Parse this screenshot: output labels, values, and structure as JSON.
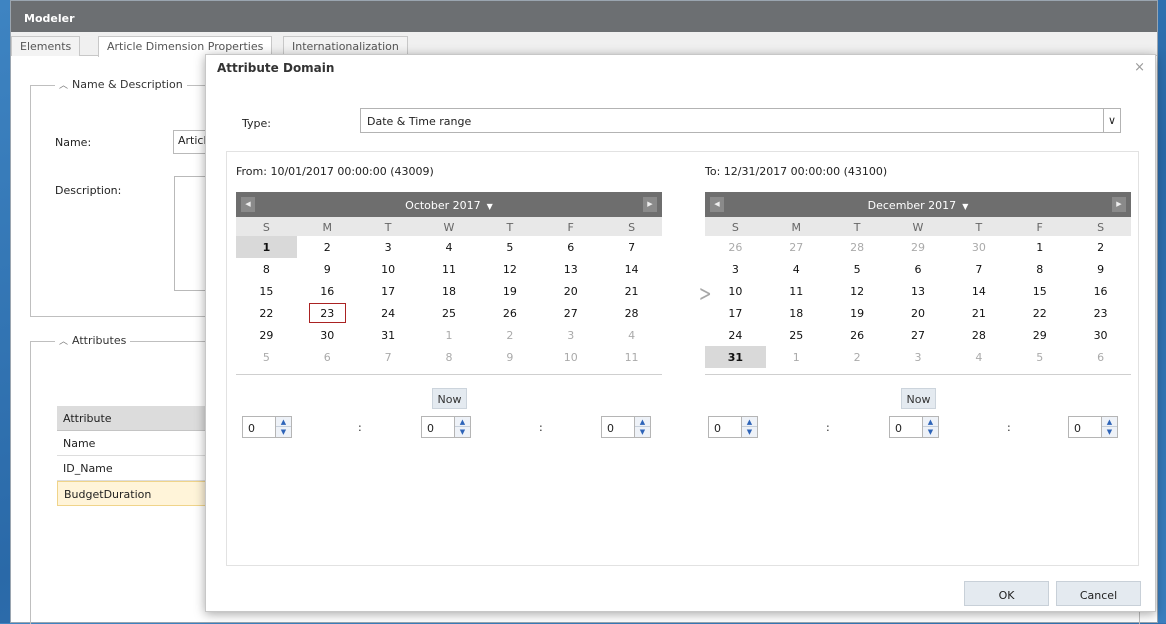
{
  "app": {
    "title": "Modeler"
  },
  "tabs": [
    {
      "label": "Elements"
    },
    {
      "label": "Article Dimension Properties"
    },
    {
      "label": "Internationalization"
    }
  ],
  "name_section": {
    "legend": "Name & Description",
    "name_label": "Name:",
    "name_value": "Article",
    "description_label": "Description:"
  },
  "attributes_section": {
    "legend": "Attributes",
    "header": "Attribute",
    "rows": [
      "Name",
      "ID_Name",
      "BudgetDuration"
    ]
  },
  "modal": {
    "title": "Attribute Domain",
    "close": "×",
    "type_label": "Type:",
    "type_value": "Date & Time range",
    "from_label": "From: 10/01/2017 00:00:00 (43009)",
    "to_label": "To: 12/31/2017 00:00:00 (43100)",
    "weekdays": [
      "S",
      "M",
      "T",
      "W",
      "T",
      "F",
      "S"
    ],
    "from_calendar": {
      "title": "October 2017",
      "weeks": [
        [
          "1",
          "2",
          "3",
          "4",
          "5",
          "6",
          "7"
        ],
        [
          "8",
          "9",
          "10",
          "11",
          "12",
          "13",
          "14"
        ],
        [
          "15",
          "16",
          "17",
          "18",
          "19",
          "20",
          "21"
        ],
        [
          "22",
          "23",
          "24",
          "25",
          "26",
          "27",
          "28"
        ],
        [
          "29",
          "30",
          "31",
          "1",
          "2",
          "3",
          "4"
        ],
        [
          "5",
          "6",
          "7",
          "8",
          "9",
          "10",
          "11"
        ]
      ],
      "selected_day": "1",
      "highlighted_day": "23",
      "now_label": "Now",
      "hour": "0",
      "minute": "0",
      "second": "0"
    },
    "to_calendar": {
      "title": "December 2017",
      "weeks": [
        [
          "26",
          "27",
          "28",
          "29",
          "30",
          "1",
          "2"
        ],
        [
          "3",
          "4",
          "5",
          "6",
          "7",
          "8",
          "9"
        ],
        [
          "10",
          "11",
          "12",
          "13",
          "14",
          "15",
          "16"
        ],
        [
          "17",
          "18",
          "19",
          "20",
          "21",
          "22",
          "23"
        ],
        [
          "24",
          "25",
          "26",
          "27",
          "28",
          "29",
          "30"
        ],
        [
          "31",
          "1",
          "2",
          "3",
          "4",
          "5",
          "6"
        ]
      ],
      "selected_day": "31",
      "now_label": "Now",
      "hour": "0",
      "minute": "0",
      "second": "0"
    },
    "time_separator": ":",
    "ok_label": "OK",
    "cancel_label": "Cancel"
  },
  "colors": {
    "titlebar": "#6c6f72",
    "calendar_header": "#6e6e6e",
    "today_border": "#aa2222",
    "desktop": "#2f72b3"
  }
}
